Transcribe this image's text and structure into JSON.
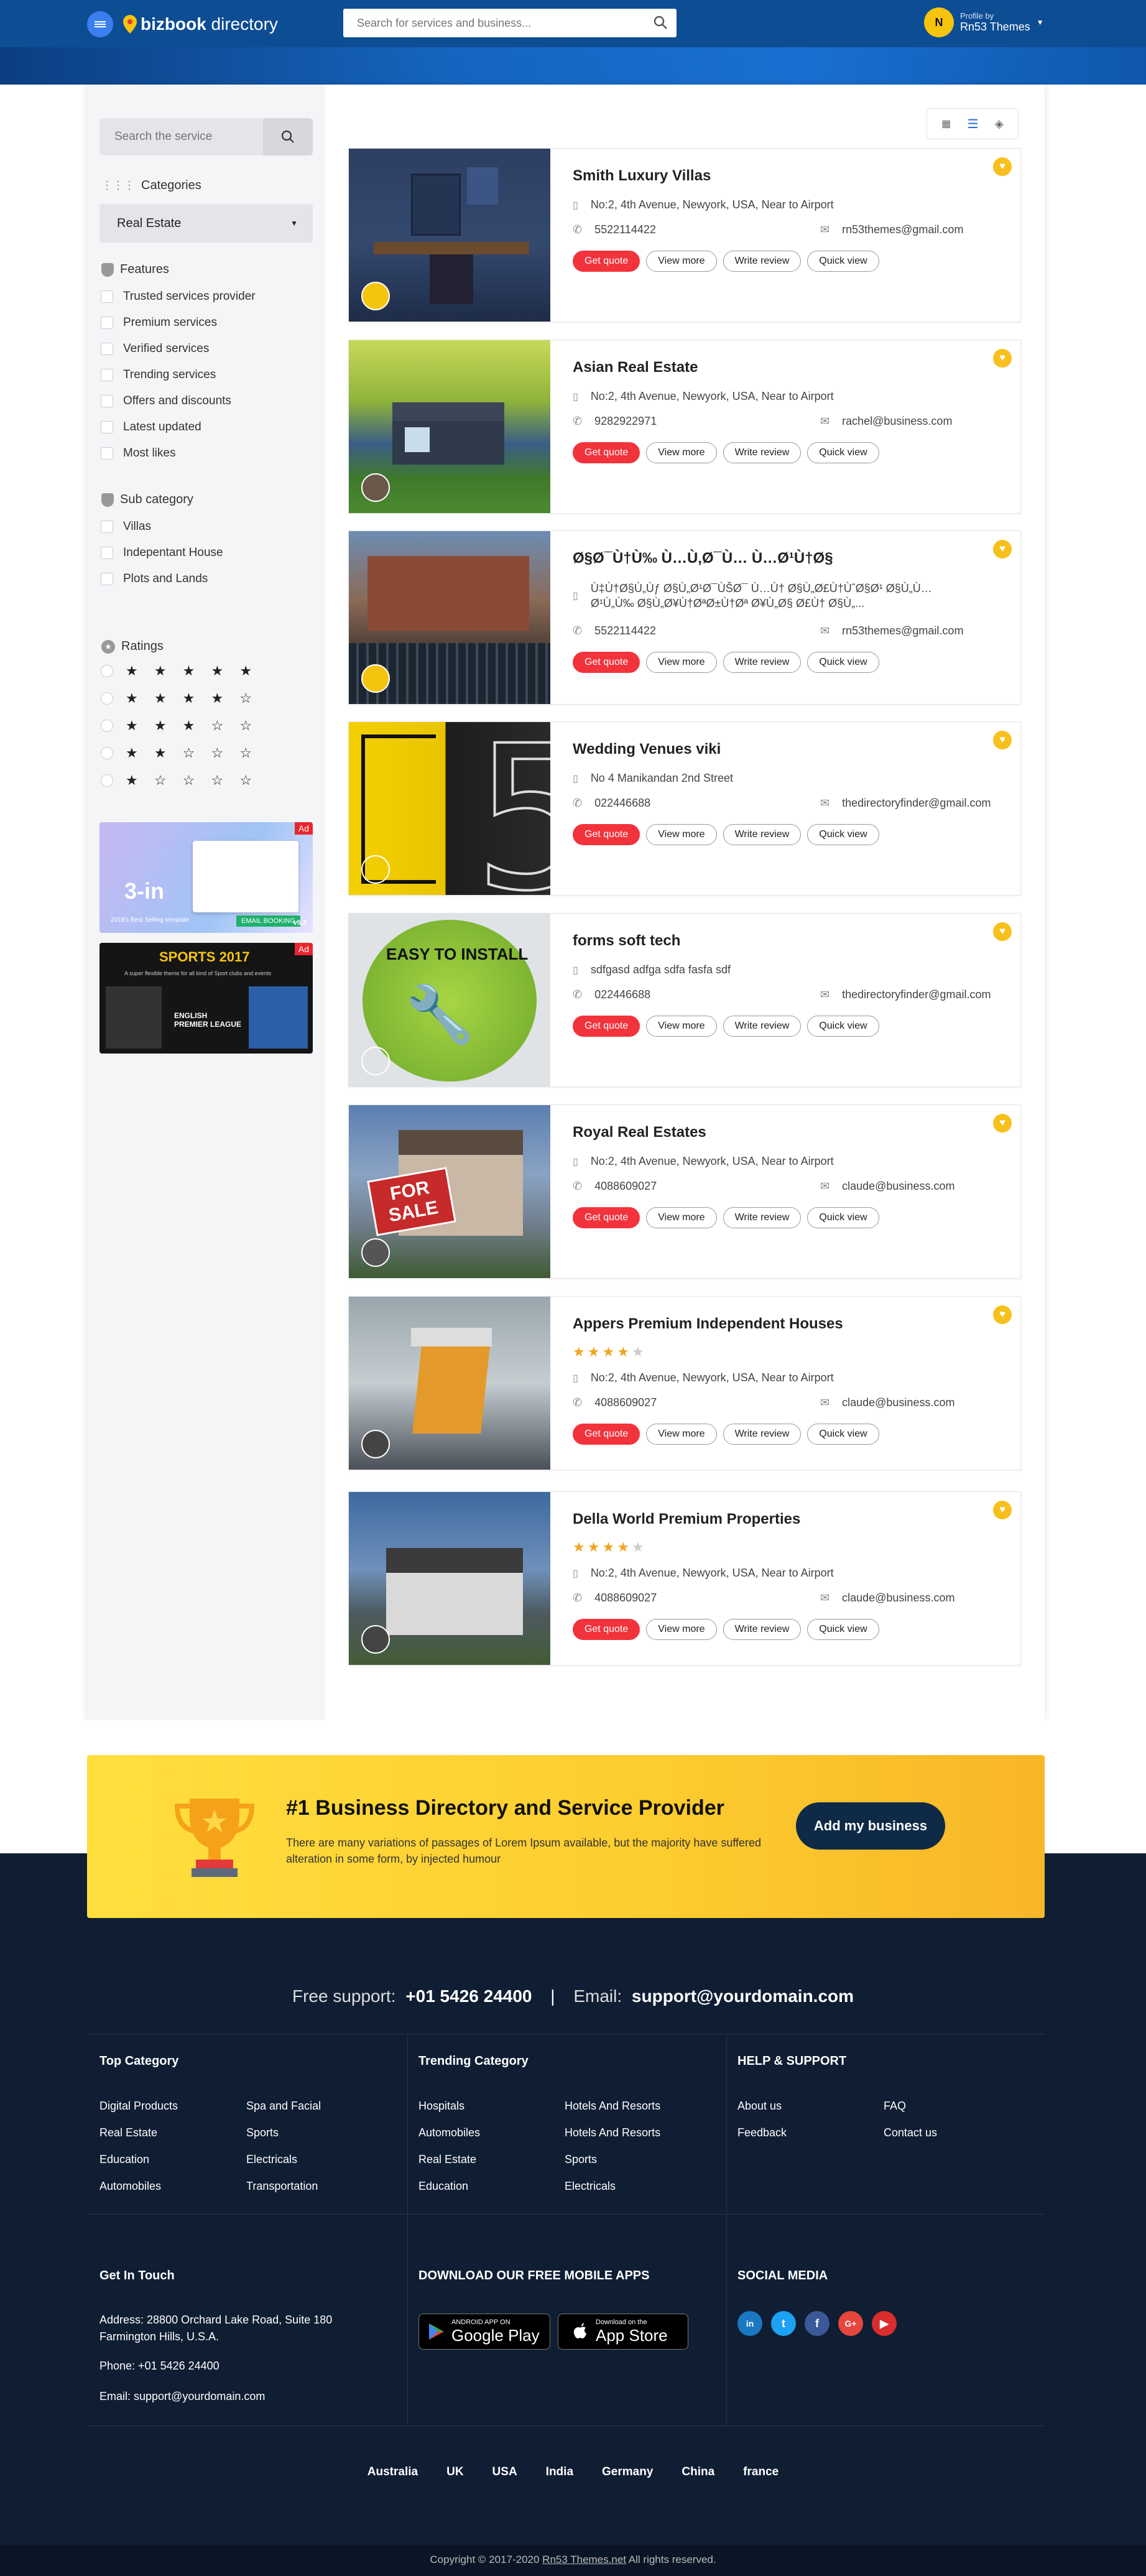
{
  "header": {
    "brand_bold": "bizbook",
    "brand_rest": "directory",
    "search_placeholder": "Search for services and business...",
    "profile_small": "Profile by",
    "profile_name": "Rn53 Themes"
  },
  "sidebar": {
    "search_placeholder": "Search the service",
    "categories_title": "Categories",
    "category_selected": "Real Estate",
    "features_title": "Features",
    "features": [
      "Trusted services provider",
      "Premium services",
      "Verified services",
      "Trending services",
      "Offers and discounts",
      "Latest updated",
      "Most likes"
    ],
    "subcategory_title": "Sub category",
    "subcategories": [
      "Villas",
      "Indepentant House",
      "Plots and Lands"
    ],
    "ratings_title": "Ratings",
    "ratings": [
      "★ ★ ★ ★ ★",
      "★ ★ ★ ★ ☆",
      "★ ★ ★ ☆ ☆",
      "★ ★ ☆ ☆ ☆",
      "★ ☆ ☆ ☆ ☆"
    ],
    "ad1": {
      "badge": "Ad",
      "big": "3-in",
      "line1": "2018's Best Selling template",
      "cta": "EMAIL BOOKING",
      "ver": "v5.2"
    },
    "ad2": {
      "badge": "Ad",
      "title": "SPORTS 2017",
      "sub": "A super flexible theme for all kind of Sport clubs and events",
      "logo": "ENGLISH PREMIER LEAGUE"
    }
  },
  "buttons": {
    "quote": "Get quote",
    "more": "View more",
    "review": "Write review",
    "quick": "Quick view"
  },
  "listings": [
    {
      "title": "Smith Luxury Villas",
      "address": "No:2, 4th Avenue, Newyork, USA, Near to Airport",
      "phone": "5522114422",
      "email": "rn53themes@gmail.com",
      "stars": 0
    },
    {
      "title": "Asian Real Estate",
      "address": "No:2, 4th Avenue, Newyork, USA, Near to Airport",
      "phone": "9282922971",
      "email": "rachel@business.com",
      "stars": 0
    },
    {
      "title": "Ø§Ø¯Ù†Ù‰ Ù…Ù‚Ø¯Ù… Ù…Ø¹Ù†Ø§",
      "address": "Ù‡Ù†Ø§Ù„Ùƒ Ø§Ù„Ø¹Ø¯ÙŠØ¯ Ù…Ù† Ø§Ù„Ø£Ù†ÙˆØ§Ø¹ Ø§Ù„Ù… Ø¹Ù„Ù‰ Ø§Ù„Ø¥Ù†ØªØ±Ù†Øª Ø¥Ù„Ø§ Ø£Ù† Ø§Ù„...",
      "phone": "5522114422",
      "email": "rn53themes@gmail.com",
      "stars": 0
    },
    {
      "title": "Wedding Venues viki",
      "address": "No 4 Manikandan 2nd Street",
      "phone": "022446688",
      "email": "thedirectoryfinder@gmail.com",
      "stars": 0
    },
    {
      "title": "forms soft tech",
      "address": "sdfgasd adfga sdfa fasfa sdf",
      "phone": "022446688",
      "email": "thedirectoryfinder@gmail.com",
      "stars": 0
    },
    {
      "title": "Royal Real Estates",
      "address": "No:2, 4th Avenue, Newyork, USA, Near to Airport",
      "phone": "4088609027",
      "email": "claude@business.com",
      "stars": 0
    },
    {
      "title": "Appers Premium Independent Houses",
      "address": "No:2, 4th Avenue, Newyork, USA, Near to Airport",
      "phone": "4088609027",
      "email": "claude@business.com",
      "stars": 4
    },
    {
      "title": "Della World Premium Properties",
      "address": "No:2, 4th Avenue, Newyork, USA, Near to Airport",
      "phone": "4088609027",
      "email": "claude@business.com",
      "stars": 4
    }
  ],
  "image_texts": {
    "install": "EASY TO INSTALL",
    "sale": "FOR SALE",
    "big5": "5"
  },
  "cta": {
    "title": "#1 Business Directory and Service Provider",
    "text": "There are many variations of passages of Lorem Ipsum available, but the majority have suffered alteration in some form, by injected humour",
    "button": "Add my business"
  },
  "footer": {
    "support_label": "Free support:",
    "support_phone": "+01 5426 24400",
    "separator": "|",
    "email_label": "Email:",
    "email_value": "support@yourdomain.com",
    "top_category_title": "Top Category",
    "top_category": [
      "Digital Products",
      "Spa and Facial",
      "Real Estate",
      "Sports",
      "Education",
      "Electricals",
      "Automobiles",
      "Transportation"
    ],
    "trending_title": "Trending Category",
    "trending": [
      "Hospitals",
      "Hotels And Resorts",
      "Automobiles",
      "Hotels And Resorts",
      "Real Estate",
      "Sports",
      "Education",
      "Electricals"
    ],
    "help_title": "HELP & SUPPORT",
    "help": [
      "About us",
      "FAQ",
      "Feedback",
      "Contact us"
    ],
    "touch_title": "Get In Touch",
    "address": "Address: 28800 Orchard Lake Road, Suite 180 Farmington Hills, U.S.A.",
    "phone": "Phone: +01 5426 24400",
    "email": "Email: support@yourdomain.com",
    "apps_title": "DOWNLOAD OUR FREE MOBILE APPS",
    "gplay_small": "ANDROID APP ON",
    "gplay_big": "Google Play",
    "apple_small": "Download on the",
    "apple_big": "App Store",
    "social_title": "SOCIAL MEDIA",
    "social": [
      "in",
      "t",
      "f",
      "G+",
      "▶"
    ],
    "countries": [
      "Australia",
      "UK",
      "USA",
      "India",
      "Germany",
      "China",
      "france"
    ],
    "copy_pre": "Copyright © 2017-2020",
    "copy_link": "Rn53 Themes.net",
    "copy_post": "All rights reserved."
  },
  "colors": {
    "header": "#0d4d94",
    "accent_red": "#f2333c",
    "heart": "#f7c01c",
    "footer": "#0f1e33"
  }
}
